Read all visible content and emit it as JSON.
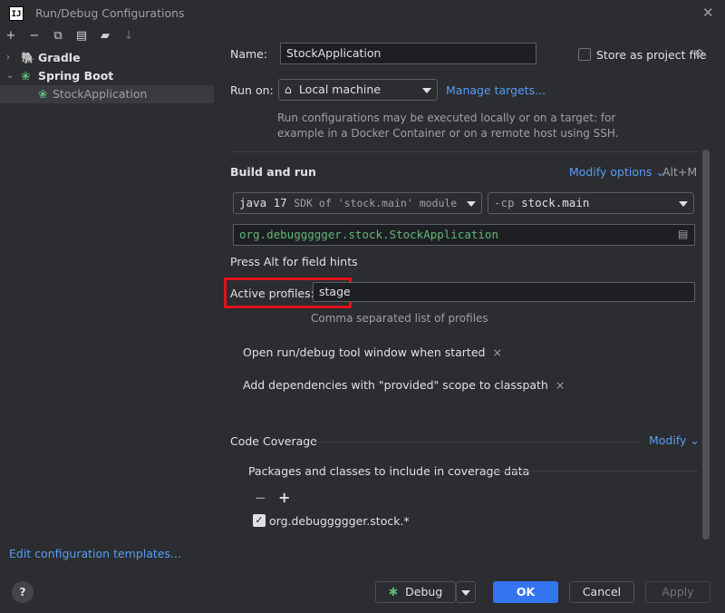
{
  "window": {
    "title": "Run/Debug Configurations",
    "logo_text": "IJ"
  },
  "toolbar": {
    "icons": [
      "add-icon",
      "remove-icon",
      "copy-icon",
      "save-icon",
      "new-folder-icon",
      "sort-icon"
    ]
  },
  "tree": {
    "items": [
      {
        "label": "Gradle"
      },
      {
        "label": "Spring Boot"
      },
      {
        "label": "StockApplication"
      }
    ]
  },
  "form": {
    "name_label": "Name:",
    "name_value": "StockApplication",
    "store_label": "Store as project file",
    "run_on_label": "Run on:",
    "run_on_value": "Local machine",
    "manage_targets": "Manage targets...",
    "run_on_desc_1": "Run configurations may be executed locally or on a target: for",
    "run_on_desc_2": "example in a Docker Container or on a remote host using SSH.",
    "build_section": "Build and run",
    "modify_options": "Modify options",
    "modify_shortcut": "Alt+M",
    "sdk_java": "java 17",
    "sdk_rest": "SDK of 'stock.main' module",
    "cp_prefix": "-cp",
    "cp_value": "stock.main",
    "main_class": "org.debuggggger.stock.StockApplication",
    "field_hints": "Press Alt for field hints",
    "profiles_label": "Active profiles:",
    "profiles_value": "stage",
    "profiles_hint": "Comma separated list of profiles",
    "chip_1": "Open run/debug tool window when started",
    "chip_2": "Add dependencies with \"provided\" scope to classpath",
    "chip_close": "×",
    "coverage_section": "Code Coverage",
    "coverage_modify": "Modify",
    "coverage_packages": "Packages and classes to include in coverage data",
    "coverage_minus": "−",
    "coverage_plus": "+",
    "coverage_entry": "org.debuggggger.stock.*"
  },
  "footer": {
    "edit_templates": "Edit configuration templates...",
    "help": "?",
    "debug_label": "Debug",
    "ok": "OK",
    "cancel": "Cancel",
    "apply": "Apply"
  }
}
